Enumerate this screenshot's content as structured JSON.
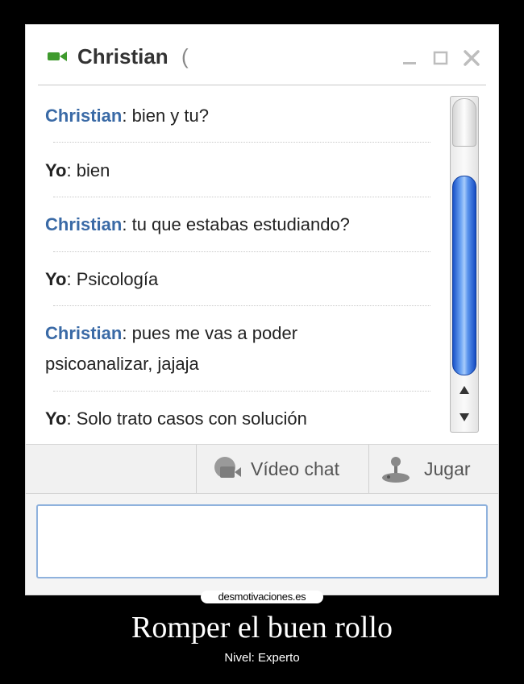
{
  "window": {
    "contact_name": "Christian",
    "status_fragment": "(",
    "icons": [
      "video-camera-icon",
      "minimize-icon",
      "maximize-icon",
      "close-icon"
    ]
  },
  "messages": [
    {
      "sender": "Christian",
      "text": ": bien y tu?"
    },
    {
      "sender": "Yo",
      "text": ": bien"
    },
    {
      "sender": "Christian",
      "text": ": tu que estabas estudiando?"
    },
    {
      "sender": "Yo",
      "text": ": Psicología"
    },
    {
      "sender": "Christian",
      "text": ": pues me vas a poder psicoanalizar, jajaja"
    },
    {
      "sender": "Yo",
      "text": ": Solo trato casos con solución"
    }
  ],
  "toolbar": {
    "video_chat_label": "Vídeo chat",
    "game_label": "Jugar"
  },
  "input": {
    "value": ""
  },
  "colors": {
    "sender_contact": "#3a6aa6",
    "scroll_thumb": "#2b6ad9",
    "input_border": "#8fb2dd",
    "camera_green": "#3f9a2e"
  },
  "footer": {
    "watermark": "desmotivaciones.es",
    "title": "Romper el buen rollo",
    "subtitle": "Nivel: Experto"
  }
}
